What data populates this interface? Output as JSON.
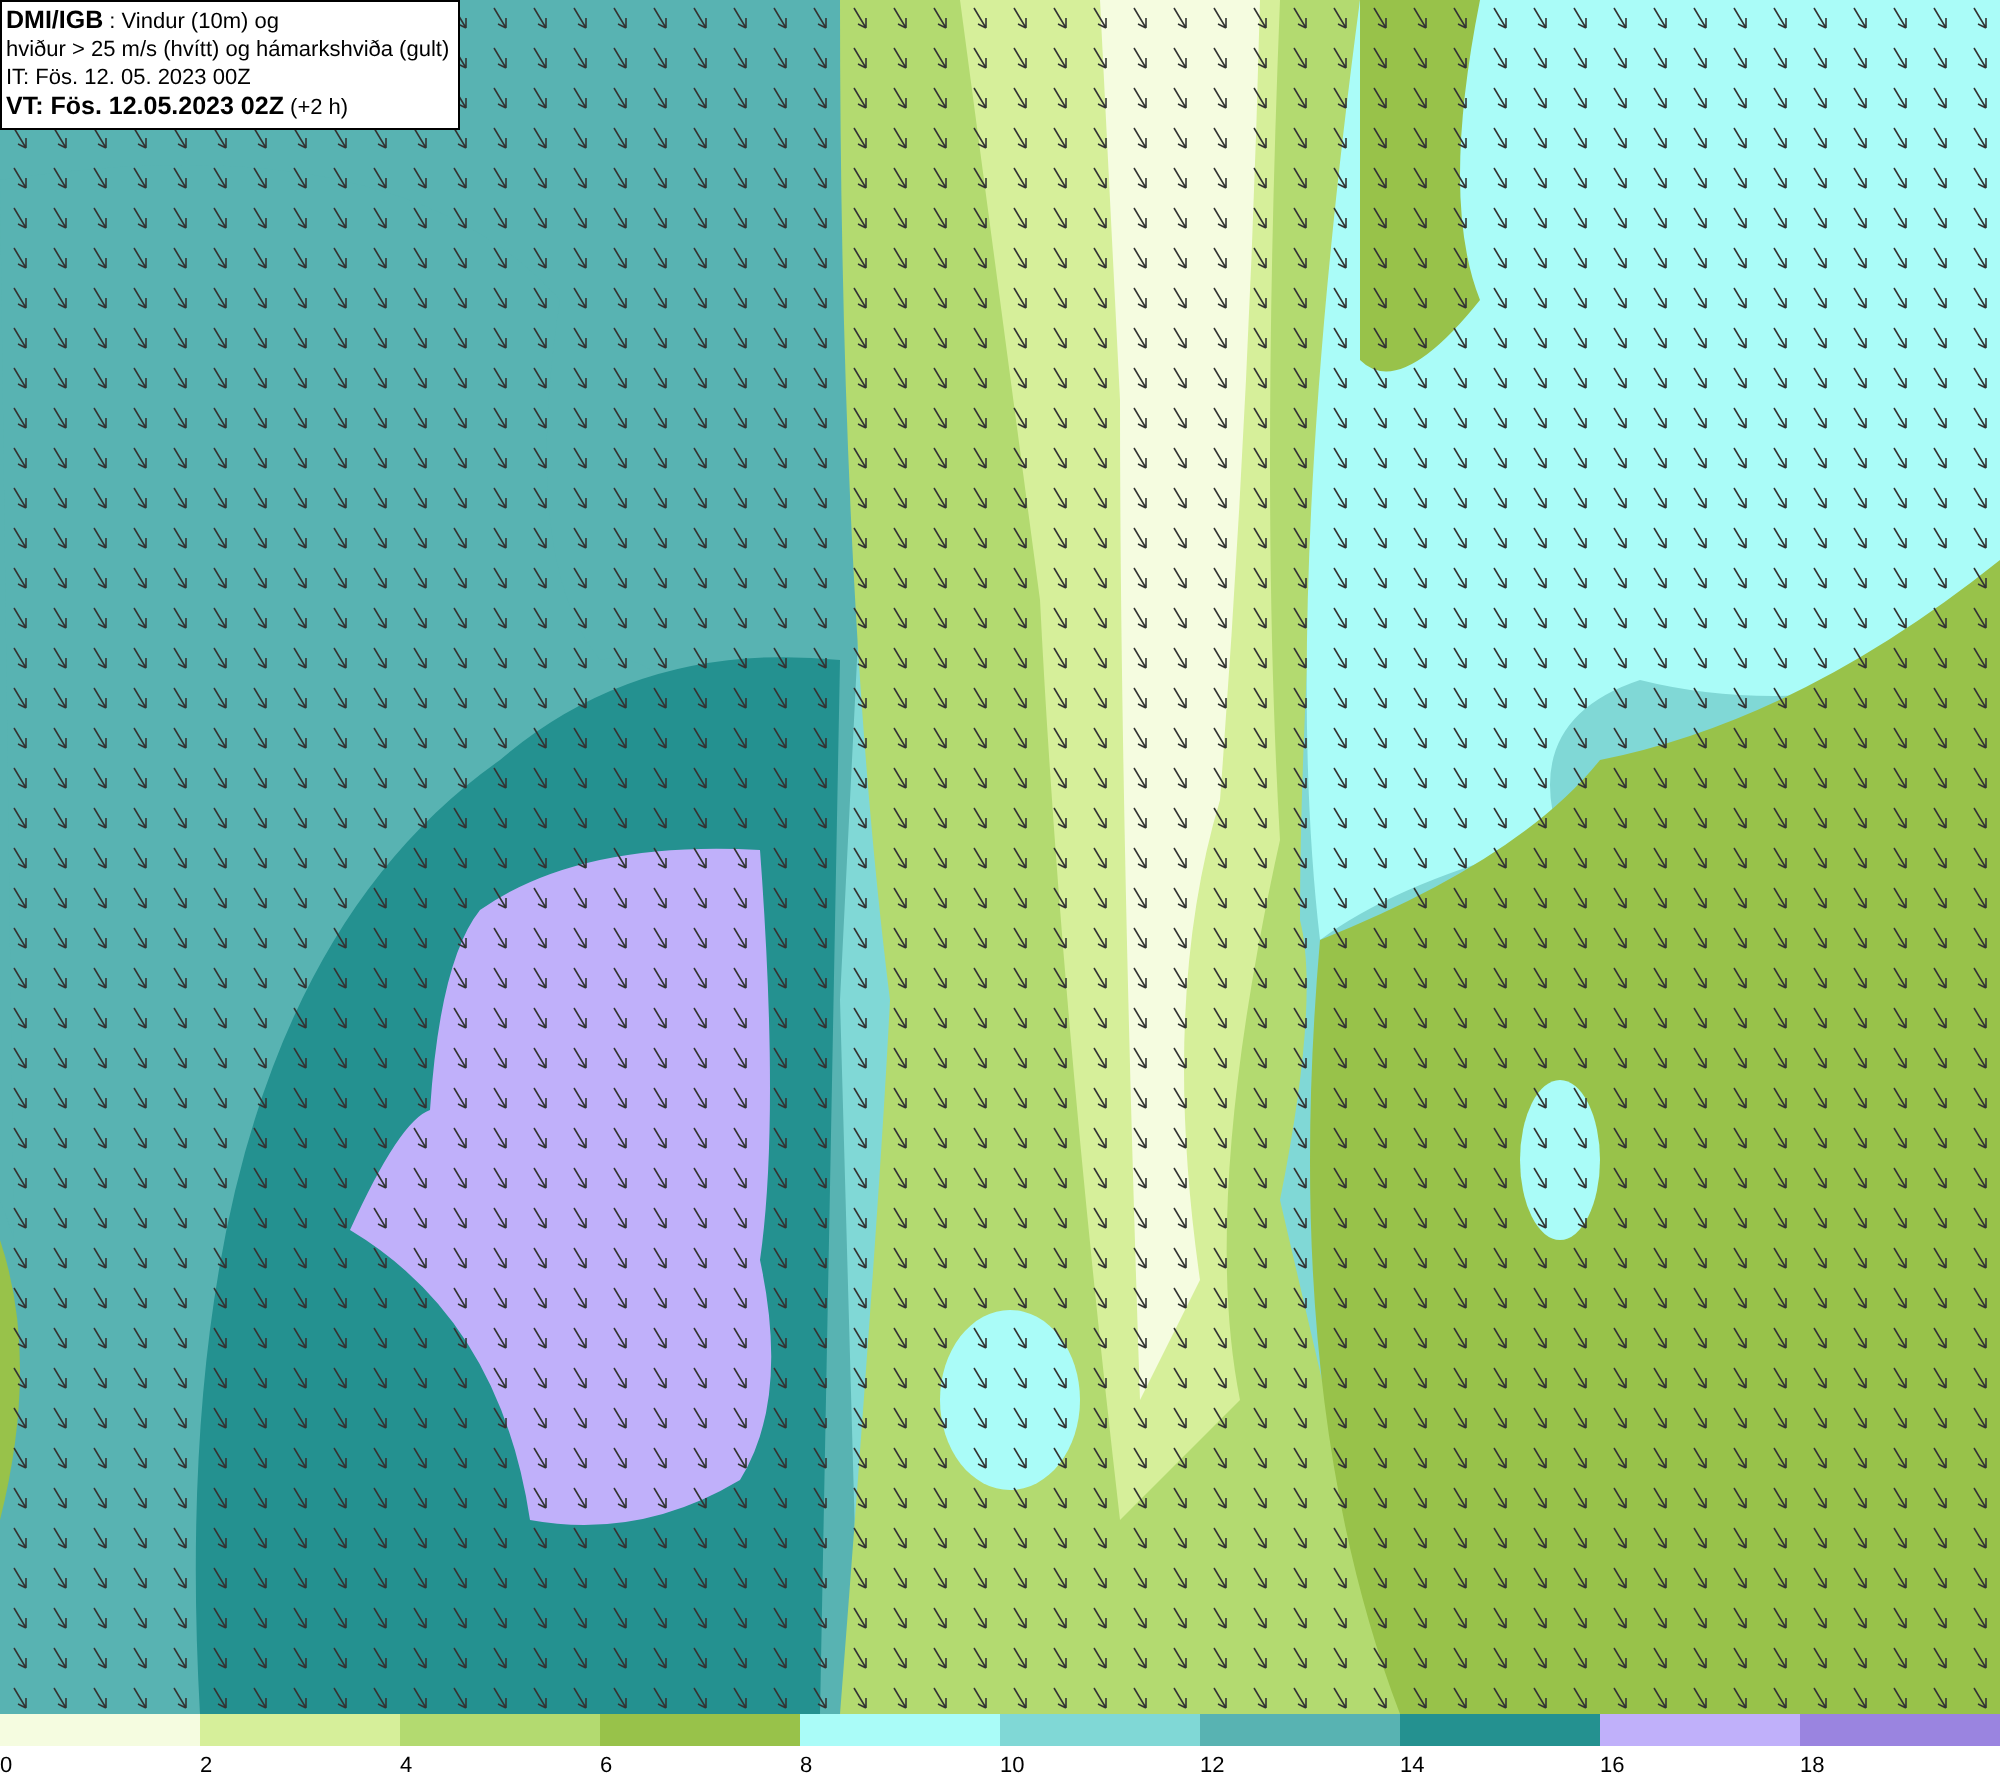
{
  "info_box": {
    "lines": [
      "**DMI/IGB** : Vindur (10m) og",
      "hviður > 25 m/s (hvítt) og hámarkshviða (gult)",
      "IT: Fös. 12. 05. 2023 00Z",
      "**VT: Fös. 12.05.2023 02Z** (+2 h)"
    ]
  },
  "legend": {
    "bins": [
      {
        "color": "#f5fce0"
      },
      {
        "color": "#d6ef9a"
      },
      {
        "color": "#b3da70"
      },
      {
        "color": "#98c24a"
      },
      {
        "color": "#aafcf8"
      },
      {
        "color": "#80d8d6"
      },
      {
        "color": "#58b3b2"
      },
      {
        "color": "#249190"
      },
      {
        "color": "#c0b0fa"
      },
      {
        "color": "#9a84e0"
      }
    ],
    "labels": [
      "0",
      "2",
      "4",
      "6",
      "8",
      "10",
      "12",
      "14",
      "16",
      "18"
    ]
  }
}
